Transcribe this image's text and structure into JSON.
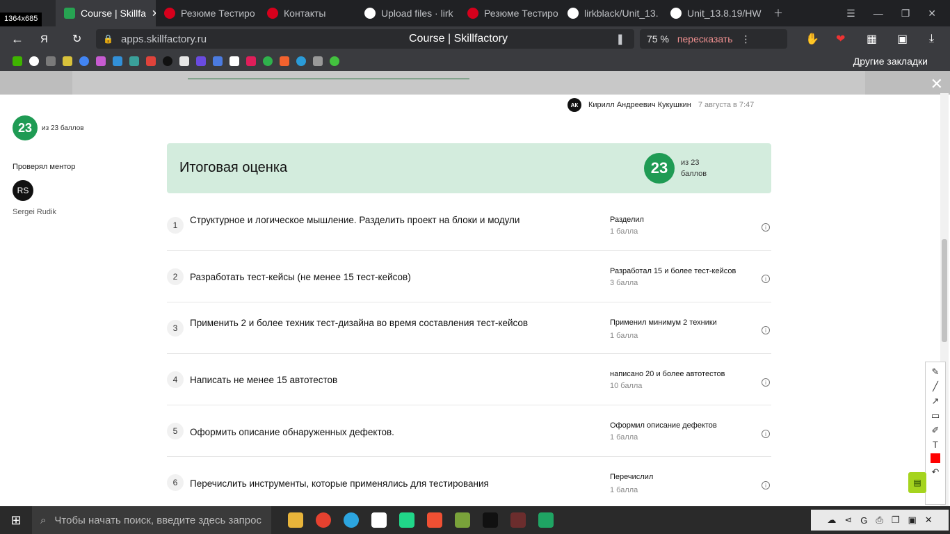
{
  "tabs": [
    {
      "label": "Course | Skillfa",
      "icon": "skillfactory-icon",
      "active": true
    },
    {
      "label": "Резюме Тестиро",
      "icon": "hh-icon"
    },
    {
      "label": "Контакты",
      "icon": "hh-icon"
    },
    {
      "label": "Upload files · lirk",
      "icon": "github-icon"
    },
    {
      "label": "Резюме Тестиро",
      "icon": "hh-icon"
    },
    {
      "label": "lirkblack/Unit_13.",
      "icon": "github-icon"
    },
    {
      "label": "Unit_13.8.19/HW",
      "icon": "github-icon"
    }
  ],
  "screenshot_dim_label": "1364x685",
  "address": {
    "url": "apps.skillfactory.ru",
    "title": "Course | Skillfactory",
    "zoom": "75 %",
    "retell": "пересказать"
  },
  "bookmarks": {
    "other": "Другие закладки"
  },
  "author": {
    "initials": "АК",
    "name": "Кирилл Андреевич Кукушкин",
    "date": "7 августа в 7:47"
  },
  "side": {
    "score": "23",
    "of": "из 23 баллов",
    "mentor_label": "Проверял ментор",
    "mentor_initials": "RS",
    "mentor_name": "Sergei Rudik"
  },
  "final": {
    "title": "Итоговая оценка",
    "score": "23",
    "of": "из 23 баллов"
  },
  "criteria": [
    {
      "n": "1",
      "text": "Структурное и логическое мышление. Разделить проект на блоки и модули",
      "result": "Разделил",
      "points": "1 балла"
    },
    {
      "n": "2",
      "text": "Разработать тест-кейсы (не менее 15 тест-кейсов)",
      "result": "Разработал 15 и более тест-кейсов",
      "points": "3 балла"
    },
    {
      "n": "3",
      "text": "Применить 2 и более техник тест-дизайна во время составления тест-кейсов",
      "result": "Применил минимум 2 техники",
      "points": "1 балла"
    },
    {
      "n": "4",
      "text": "Написать не менее 15 автотестов",
      "result": "написано 20 и более автотестов",
      "points": "10 балла"
    },
    {
      "n": "5",
      "text": "Оформить описание обнаруженных дефектов.",
      "result": "Оформил описание дефектов",
      "points": "1 балла"
    },
    {
      "n": "6",
      "text": "Перечислить инструменты, которые применялись для тестирования",
      "result": "Перечислил",
      "points": "1 балла"
    }
  ],
  "taskbar": {
    "search_placeholder": "Чтобы начать поиск, введите здесь запрос"
  }
}
